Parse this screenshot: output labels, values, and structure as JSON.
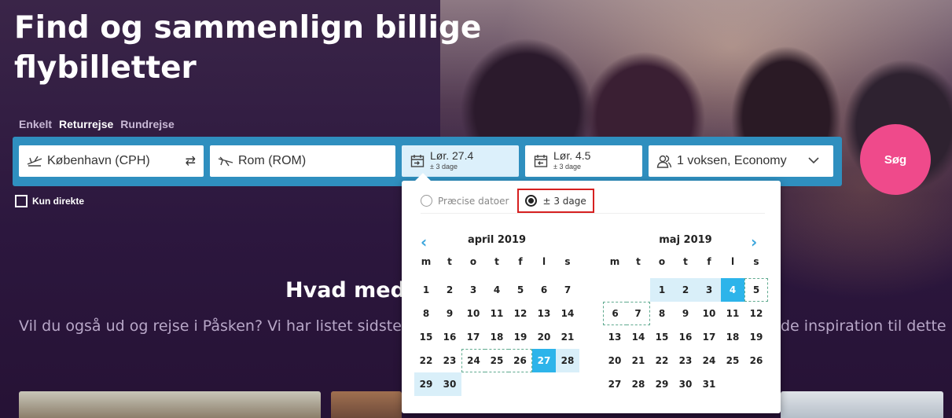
{
  "hero": {
    "title": "Find og sammenlign billige flybilletter"
  },
  "trip_tabs": [
    {
      "label": "Enkelt",
      "active": false
    },
    {
      "label": "Returrejse",
      "active": true
    },
    {
      "label": "Rundrejse",
      "active": false
    }
  ],
  "search": {
    "origin": "København (CPH)",
    "destination": "Rom (ROM)",
    "depart": {
      "date": "Lør. 27.4",
      "flex": "± 3 dage"
    },
    "return": {
      "date": "Lør. 4.5",
      "flex": "± 3 dage"
    },
    "passengers": "1 voksen, Economy",
    "button": "Søg",
    "direct_only": "Kun direkte"
  },
  "date_picker": {
    "options": [
      {
        "label": "Præcise datoer",
        "selected": false
      },
      {
        "label": "± 3 dage",
        "selected": true
      }
    ],
    "weekdays": [
      "m",
      "t",
      "o",
      "t",
      "f",
      "l",
      "s"
    ],
    "months": [
      {
        "title": "april 2019",
        "offset": 0,
        "days": [
          "1",
          "2",
          "3",
          "4",
          "5",
          "6",
          "7",
          "8",
          "9",
          "10",
          "11",
          "12",
          "13",
          "14",
          "15",
          "16",
          "17",
          "18",
          "19",
          "20",
          "21",
          "22",
          "23",
          "24",
          "25",
          "26",
          "27",
          "28",
          "29",
          "30"
        ],
        "range": [
          "28",
          "29",
          "30"
        ],
        "selected": "27",
        "flex": [
          "24",
          "25",
          "26"
        ]
      },
      {
        "title": "maj 2019",
        "offset": 2,
        "days": [
          "1",
          "2",
          "3",
          "4",
          "5",
          "6",
          "7",
          "8",
          "9",
          "10",
          "11",
          "12",
          "13",
          "14",
          "15",
          "16",
          "17",
          "18",
          "19",
          "20",
          "21",
          "22",
          "23",
          "24",
          "25",
          "26",
          "27",
          "28",
          "29",
          "30",
          "31"
        ],
        "range": [
          "1",
          "2",
          "3"
        ],
        "selected": "4",
        "flex": [
          "5",
          "6",
          "7"
        ]
      }
    ]
  },
  "content": {
    "section_title": "Hvad med",
    "section_sub_left": "Vil du også ud og rejse i Påsken? Vi har listet sidste å",
    "section_sub_right": "de inspiration til dette"
  },
  "colors": {
    "search_bar": "#2f8fbf",
    "search_button": "#ef4a8b",
    "selected_day": "#2db4ea",
    "range_day": "#d9eff9",
    "highlight_box": "#d62020"
  }
}
